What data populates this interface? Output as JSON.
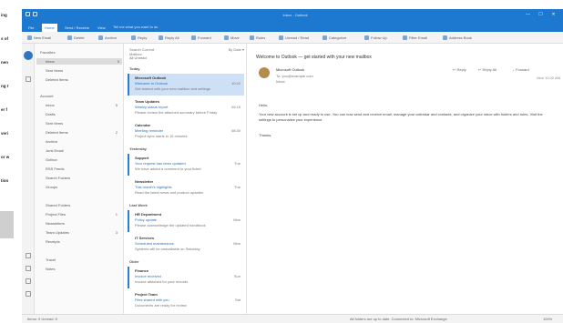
{
  "app": {
    "title": "Inbox - Outlook",
    "window_controls": [
      "—",
      "☐",
      "✕"
    ],
    "tabs": [
      {
        "label": "File",
        "active": false
      },
      {
        "label": "Home",
        "active": true
      },
      {
        "label": "Send / Receive",
        "active": false
      },
      {
        "label": "View",
        "active": false
      }
    ],
    "tell_me": "Tell me what you want to do",
    "accent": "#1d78cf"
  },
  "ribbon": {
    "buttons": [
      {
        "label": "New Email",
        "icon": "new-email-icon"
      },
      {
        "label": "Delete",
        "icon": "delete-icon"
      },
      {
        "label": "Archive",
        "icon": "archive-icon"
      },
      {
        "label": "Reply",
        "icon": "reply-icon"
      },
      {
        "label": "Reply All",
        "icon": "reply-all-icon"
      },
      {
        "label": "Forward",
        "icon": "forward-icon"
      },
      {
        "label": "Move",
        "icon": "move-icon"
      },
      {
        "label": "Rules",
        "icon": "rules-icon"
      },
      {
        "label": "Unread / Read",
        "icon": "read-icon"
      },
      {
        "label": "Categorize",
        "icon": "categorize-icon"
      },
      {
        "label": "Follow Up",
        "icon": "flag-icon"
      },
      {
        "label": "Filter Email",
        "icon": "filter-icon"
      },
      {
        "label": "Address Book",
        "icon": "address-book-icon"
      }
    ]
  },
  "left_strip": {
    "words": [
      "ing",
      "s of",
      "nen",
      "ng t",
      "er f",
      "veri",
      "or w",
      "tion"
    ]
  },
  "folders": {
    "items": [
      {
        "label": "Favorites",
        "count": ""
      },
      {
        "label": "Inbox",
        "count": "5",
        "selected": true
      },
      {
        "label": "Sent Items",
        "count": ""
      },
      {
        "label": "Deleted Items",
        "count": ""
      },
      {
        "label": "Account",
        "count": ""
      },
      {
        "label": "Inbox",
        "count": "5"
      },
      {
        "label": "Drafts",
        "count": ""
      },
      {
        "label": "Sent Items",
        "count": ""
      },
      {
        "label": "Deleted Items",
        "count": "2"
      },
      {
        "label": "Archive",
        "count": ""
      },
      {
        "label": "Junk Email",
        "count": ""
      },
      {
        "label": "Outbox",
        "count": ""
      },
      {
        "label": "RSS Feeds",
        "count": ""
      },
      {
        "label": "Search Folders",
        "count": ""
      },
      {
        "label": "Groups",
        "count": ""
      },
      {
        "label": "Shared Folders",
        "count": ""
      },
      {
        "label": "Project Files",
        "count": "1"
      },
      {
        "label": "Newsletters",
        "count": ""
      },
      {
        "label": "Team Updates",
        "count": "3"
      },
      {
        "label": "Receipts",
        "count": ""
      },
      {
        "label": "Travel",
        "count": ""
      },
      {
        "label": "Notes",
        "count": ""
      }
    ]
  },
  "message_list": {
    "search_placeholder": "Search Current Mailbox",
    "sort_label": "By Date ▾",
    "filter_tabs": "All    Unread",
    "groups": [
      "Today",
      "Yesterday",
      "Last Week",
      "Older"
    ],
    "messages": [
      {
        "from": "Microsoft Outlook",
        "subject": "Welcome to Outlook",
        "preview": "Get started with your new mailbox and settings",
        "time": "10:42",
        "unread": true,
        "selected": true
      },
      {
        "from": "Team Updates",
        "subject": "Weekly status report",
        "preview": "Please review the attached summary before Friday",
        "time": "09:15",
        "unread": false,
        "selected": false
      },
      {
        "from": "Calendar",
        "subject": "Meeting reminder",
        "preview": "Project sync starts in 15 minutes",
        "time": "08:30",
        "unread": false,
        "selected": false
      },
      {
        "from": "Support",
        "subject": "Your request has been updated",
        "preview": "We have added a comment to your ticket",
        "time": "Tue",
        "unread": true,
        "selected": false
      },
      {
        "from": "Newsletter",
        "subject": "This month's highlights",
        "preview": "Read the latest news and product updates",
        "time": "Tue",
        "unread": false,
        "selected": false
      },
      {
        "from": "HR Department",
        "subject": "Policy update",
        "preview": "Please acknowledge the updated handbook",
        "time": "Mon",
        "unread": true,
        "selected": false
      },
      {
        "from": "IT Services",
        "subject": "Scheduled maintenance",
        "preview": "Systems will be unavailable on Saturday",
        "time": "Mon",
        "unread": false,
        "selected": false
      },
      {
        "from": "Finance",
        "subject": "Invoice received",
        "preview": "Invoice attached for your records",
        "time": "Sun",
        "unread": true,
        "selected": false
      },
      {
        "from": "Project Team",
        "subject": "Files shared with you",
        "preview": "Documents are ready for review",
        "time": "Sat",
        "unread": false,
        "selected": false
      }
    ]
  },
  "reading_pane": {
    "subject": "Welcome to Outlook — get started with your new mailbox",
    "from": "Microsoft Outlook",
    "to": "To: you@example.com",
    "line3": "Inbox",
    "actions": [
      "↩ Reply",
      "↩ Reply All",
      "→ Forward"
    ],
    "date": "Mon 10:42 AM",
    "greeting": "Hello,",
    "body": "Your new account is set up and ready to use. You can now send and receive email, manage your calendar and contacts, and organize your inbox with folders and rules. Visit the settings to personalize your experience.",
    "signature": "Thanks,"
  },
  "statusbar": {
    "items": "Items: 9    Unread: 5",
    "connection": "All folders are up to date.   Connected to: Microsoft Exchange",
    "zoom": "100%"
  }
}
